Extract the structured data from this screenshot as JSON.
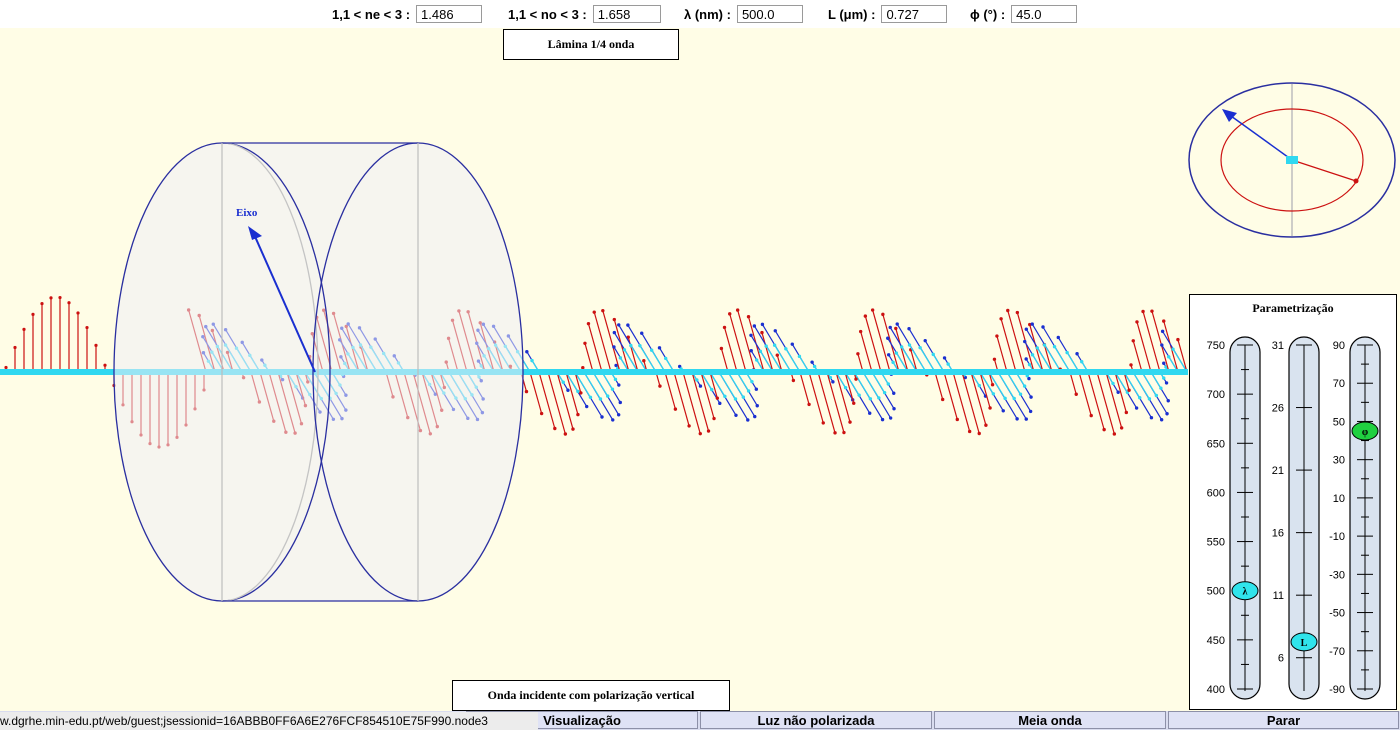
{
  "fields": [
    {
      "label": "1,1 < ne < 3 :",
      "value": "1.486"
    },
    {
      "label": "1,1 < no < 3 :",
      "value": "1.658"
    },
    {
      "label": "λ (nm) :",
      "value": "500.0"
    },
    {
      "label": "L (μm) :",
      "value": "0.727"
    },
    {
      "label": "ϕ (°) :",
      "value": "45.0"
    }
  ],
  "scene": {
    "plate_title": "Lâmina 1/4 onda",
    "axis_label": "Eixo",
    "incident_label": "Onda incidente com polarização vertical"
  },
  "parametrization": {
    "title": "Parametrização",
    "sliders": [
      {
        "name": "lambda",
        "knob": "λ",
        "min": 400,
        "max": 750,
        "value": 500.0,
        "ticks": [
          "750",
          "700",
          "650",
          "600",
          "550",
          "500",
          "450",
          "400"
        ],
        "knob_color": "#30e4ec"
      },
      {
        "name": "L",
        "knob": "L",
        "min": 3.5,
        "max": 31,
        "value": 7.27,
        "ticks": [
          "31",
          "26",
          "21",
          "16",
          "11",
          "6"
        ],
        "tick_values": [
          31,
          26,
          21,
          16,
          11,
          6
        ],
        "knob_color": "#30e4ec"
      },
      {
        "name": "phi",
        "knob": "φ",
        "min": -90,
        "max": 90,
        "value": 45.0,
        "ticks": [
          "90",
          "70",
          "50",
          "30",
          "10",
          "-10",
          "-30",
          "-50",
          "-70",
          "-90"
        ],
        "knob_color": "#20d040"
      }
    ]
  },
  "buttons": {
    "visualizacao": "Visualização",
    "luz_nao_polarizada": "Luz não polarizada",
    "meia_onda": "Meia onda",
    "parar": "Parar"
  },
  "status_url": "w.dgrhe.min-edu.pt/web/guest;jsessionid=16ABBB0FF6A6E276FCF854510E75F990.node3",
  "colors": {
    "background": "#fffde6",
    "wave_red": "#cc1111",
    "wave_blue": "#1a2fd0",
    "wave_cyan": "#30d8f0",
    "plate_outline": "#2a2fa0"
  }
}
